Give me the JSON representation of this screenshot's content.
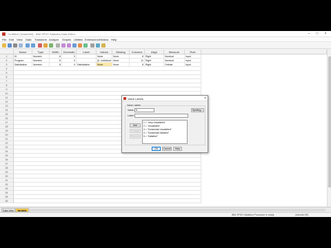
{
  "window": {
    "title": "*Untitled1 [DataSet0] - IBM SPSS Statistics Data Editor"
  },
  "menu": [
    "File",
    "Edit",
    "View",
    "Data",
    "Transform",
    "Analyze",
    "Graphs",
    "Utilities",
    "Extensions",
    "Window",
    "Help"
  ],
  "columns": [
    "Name",
    "Type",
    "Width",
    "Decimals",
    "Label",
    "Values",
    "Missing",
    "Columns",
    "Align",
    "Measure",
    "Role"
  ],
  "rows": [
    {
      "num": "1",
      "name": "ID",
      "type": "Numeric",
      "width": "8",
      "decimals": "0",
      "label": "",
      "values": "None",
      "missing": "None",
      "columns": "8",
      "align": "Right",
      "measure": "Nominal",
      "role": "Input"
    },
    {
      "num": "2",
      "name": "Program",
      "type": "Numeric",
      "width": "8",
      "decimals": "0",
      "label": "",
      "values": "{0, Individual...",
      "missing": "None",
      "columns": "11",
      "align": "Right",
      "measure": "Nominal",
      "role": "Input"
    },
    {
      "num": "3",
      "name": "Satisfaction",
      "type": "Numeric",
      "width": "8",
      "decimals": "0",
      "label": "Satisfaction",
      "values": "None",
      "missing": "None",
      "columns": "8",
      "align": "Right",
      "measure": "Ordinal",
      "role": "Input"
    }
  ],
  "empty_rows": [
    "4",
    "5",
    "6",
    "7",
    "8",
    "9",
    "10",
    "11",
    "12",
    "13",
    "14",
    "15",
    "16",
    "17",
    "18",
    "19",
    "20",
    "21",
    "22",
    "23",
    "24",
    "25",
    "26",
    "27",
    "28",
    "29",
    "30",
    "31",
    "32",
    "33",
    "34",
    "35",
    "36"
  ],
  "tabs": {
    "data_view": "Data View",
    "variable_view": "Variable View"
  },
  "status": {
    "processor": "IBM SPSS Statistics Processor is ready",
    "encoding": "Unicode:ON"
  },
  "dialog": {
    "title": "Value Labels",
    "group": "Value Labels",
    "value_label": "Value:",
    "value": "5",
    "label_label": "Label:",
    "label": "",
    "spelling": "Spelling...",
    "add": "Add",
    "change": "Change",
    "remove": "Remove",
    "list": [
      "1 = \"Very Unsatisfied\"",
      "2 = \"Unsatisfied\"",
      "3 = \"Somewhat Unsatisfied\"",
      "4 = \"Somewhat Satisfied\"",
      "5 = \"Satisfied\""
    ],
    "ok": "OK",
    "cancel": "Cancel",
    "help": "Help"
  },
  "colors": {
    "accent": "#0078d7",
    "highlight": "#fde9a8",
    "active_tab": "#f7c948"
  }
}
